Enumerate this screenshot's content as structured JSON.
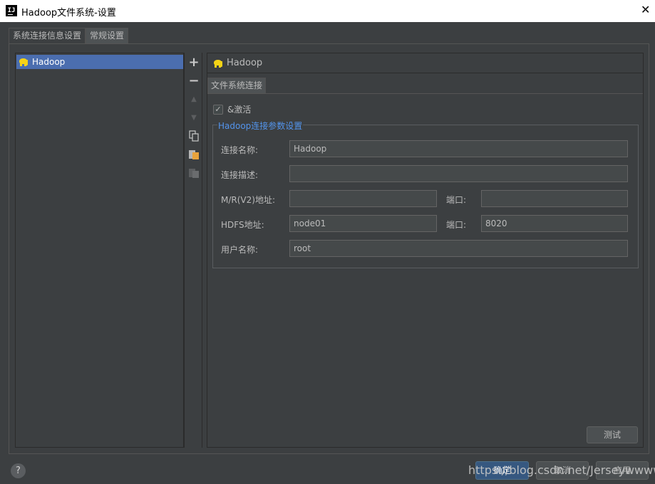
{
  "window": {
    "title": "Hadoop文件系统-设置",
    "app_icon_text": "IJ",
    "close_glyph": "✕"
  },
  "tabs": [
    {
      "label": "系统连接信息设置"
    },
    {
      "label": "常规设置"
    }
  ],
  "list": {
    "items": [
      {
        "label": "Hadoop"
      }
    ]
  },
  "toolbar": {
    "add": "+",
    "remove": "−",
    "up": "▲",
    "down": "▼",
    "copy": "⎘",
    "paste": "⧉",
    "delete": "⧉"
  },
  "detail": {
    "header": "Hadoop",
    "subtab": "文件系统连接",
    "activate_label": "&激活",
    "activate_checked": true,
    "group_title": "Hadoop连接参数设置",
    "fields": {
      "name": {
        "label": "连接名称:",
        "value": "Hadoop"
      },
      "description": {
        "label": "连接描述:",
        "value": ""
      },
      "mr_address": {
        "label": "M/R(V2)地址:",
        "value": ""
      },
      "mr_port": {
        "label": "端口:",
        "value": ""
      },
      "hdfs_address": {
        "label": "HDFS地址:",
        "value": "node01"
      },
      "hdfs_port": {
        "label": "端口:",
        "value": "8020"
      },
      "username": {
        "label": "用户名称:",
        "value": "root"
      }
    },
    "test_button": "测试"
  },
  "footer": {
    "help": "?",
    "ok": "确定",
    "cancel": "取消",
    "apply": "应用",
    "watermark": "https://blog.csdn.net/Jerseywwwwei"
  }
}
